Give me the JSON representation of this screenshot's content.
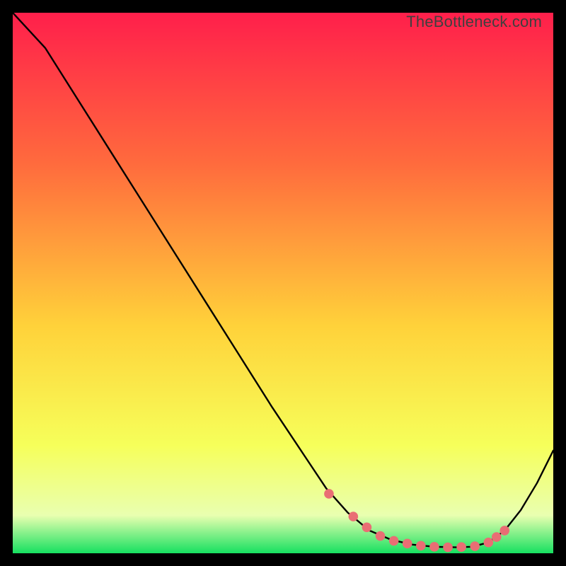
{
  "watermark": "TheBottleneck.com",
  "colors": {
    "bg": "#000000",
    "gradient_top": "#ff1f4b",
    "gradient_mid_upper": "#ff6b3d",
    "gradient_mid": "#ffd23a",
    "gradient_mid_lower": "#f6ff5a",
    "gradient_low": "#e9ffb0",
    "gradient_bottom": "#16e060",
    "curve": "#000000",
    "marker_fill": "#e96e74",
    "marker_stroke": "#c85058"
  },
  "chart_data": {
    "type": "line",
    "title": "",
    "xlabel": "",
    "ylabel": "",
    "xlim": [
      0,
      100
    ],
    "ylim": [
      0,
      100
    ],
    "series": [
      {
        "name": "curve",
        "x": [
          0,
          6,
          12,
          18,
          24,
          30,
          36,
          42,
          48,
          54,
          58,
          62,
          66,
          70,
          74,
          78,
          82,
          85,
          88,
          91,
          94,
          97,
          100
        ],
        "values": [
          100,
          93.5,
          84,
          74.5,
          65,
          55.5,
          46,
          36.5,
          27,
          18,
          12,
          7.5,
          4.2,
          2.5,
          1.6,
          1.2,
          1.1,
          1.2,
          2.0,
          4.2,
          8.0,
          13.0,
          19.0
        ]
      }
    ],
    "markers": {
      "name": "highlight-points",
      "x": [
        58.5,
        63,
        65.5,
        68,
        70.5,
        73,
        75.5,
        78,
        80.5,
        83,
        85.5,
        88,
        89.5,
        91
      ],
      "values": [
        11.0,
        6.8,
        4.8,
        3.2,
        2.3,
        1.8,
        1.4,
        1.2,
        1.1,
        1.15,
        1.3,
        2.0,
        3.0,
        4.2
      ]
    }
  }
}
